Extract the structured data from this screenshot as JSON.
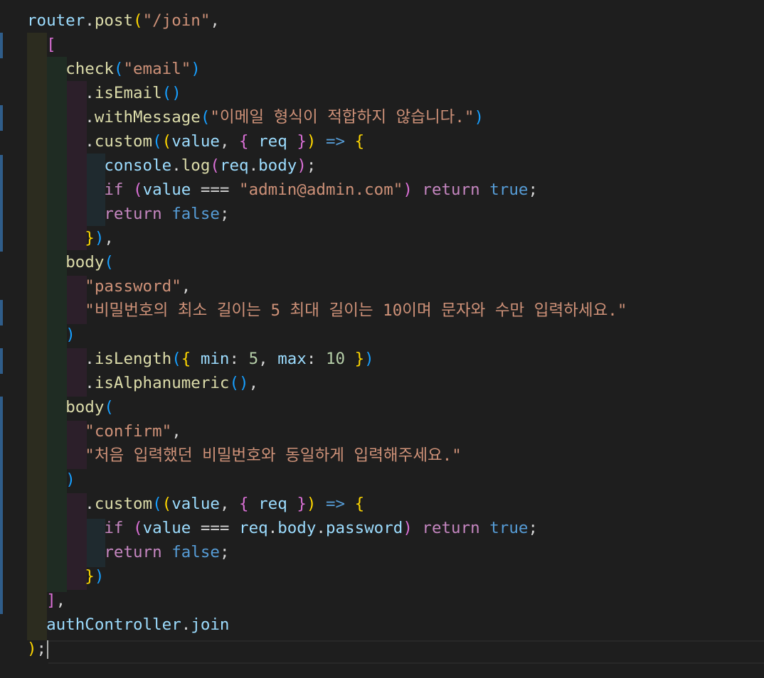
{
  "editor": {
    "language": "javascript",
    "theme_colors": {
      "background": "#1e1e1e",
      "variable": "#9cdcfe",
      "function": "#dcdcaa",
      "string": "#ce9178",
      "keyword": "#c586c0",
      "boolean": "#569cd6",
      "number": "#b5cea8",
      "bracket_level_1": "#ffd700",
      "bracket_level_2": "#da70d6",
      "bracket_level_3": "#179fff"
    },
    "tokens": {
      "router": "router",
      "post": "post",
      "join_path": "\"/join\"",
      "check": "check",
      "email_str": "\"email\"",
      "isEmail": "isEmail",
      "withMessage": "withMessage",
      "email_msg": "\"이메일 형식이 적합하지 않습니다.\"",
      "custom": "custom",
      "value": "value",
      "req": "req",
      "console": "console",
      "log": "log",
      "body_prop": "body",
      "if_kw": "if",
      "admin_email": "\"admin@admin.com\"",
      "return_kw": "return",
      "true_kw": "true",
      "false_kw": "false",
      "body_fn": "body",
      "password_str": "\"password\"",
      "password_msg": "\"비밀번호의 최소 길이는 5 최대 길이는 10이며 문자와 수만 입력하세요.\"",
      "isLength": "isLength",
      "min": "min",
      "min_val": "5",
      "max": "max",
      "max_val": "10",
      "isAlphanumeric": "isAlphanumeric",
      "confirm_str": "\"confirm\"",
      "confirm_msg": "\"처음 입력했던 비밀번호와 동일하게 입력해주세요.\"",
      "password_prop": "password",
      "authController": "authController",
      "join_fn": "join"
    }
  }
}
